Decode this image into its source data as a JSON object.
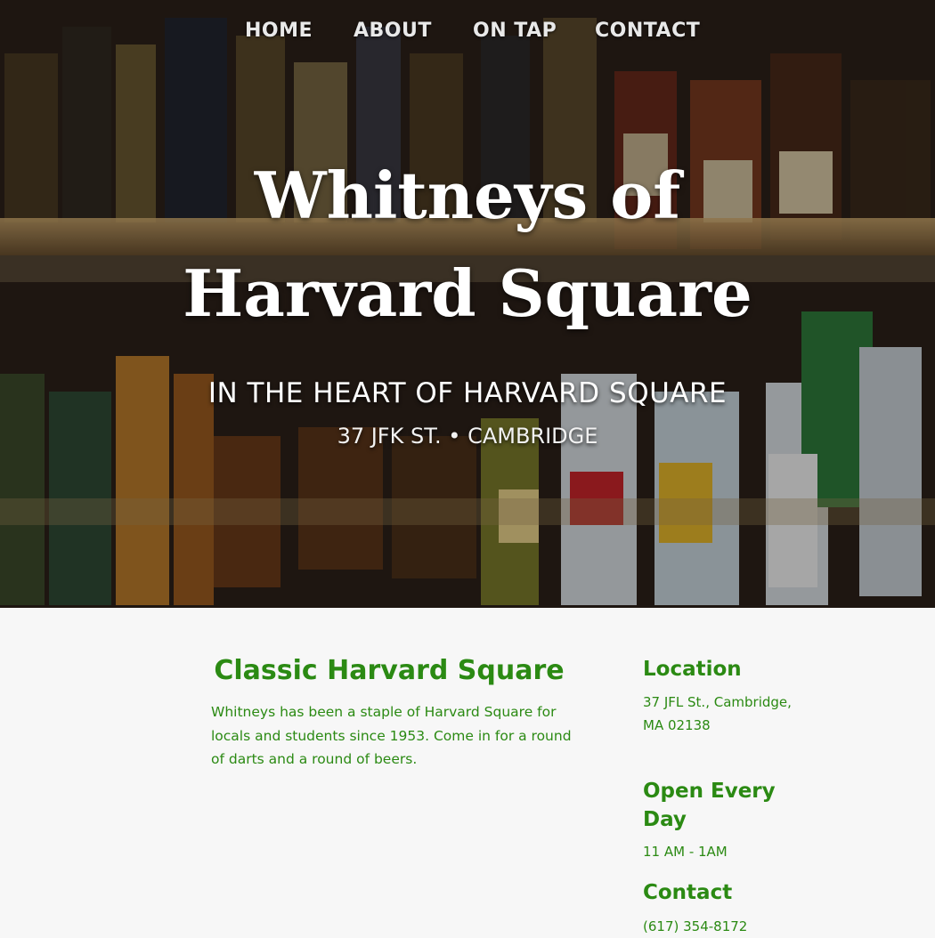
{
  "nav": {
    "items": [
      {
        "label": "HOME"
      },
      {
        "label": "ABOUT"
      },
      {
        "label": "ON TAP"
      },
      {
        "label": "CONTACT"
      }
    ]
  },
  "hero": {
    "title": "Whitneys of Harvard Square",
    "subtitle": "IN THE HEART OF HARVARD SQUARE",
    "address": "37 JFK ST. • CAMBRIDGE",
    "background": "bar-shelf-bottles-photo"
  },
  "intro": {
    "title": "Classic Harvard Square",
    "text": "Whitneys has been a staple of Harvard Square for locals and students since 1953. Come in for a round of darts and a round of beers."
  },
  "sidebar": {
    "location": {
      "heading": "Location",
      "text": "37 JFL St., Cambridge, MA 02138"
    },
    "hours": {
      "heading": "Open Every Day",
      "text": "11 AM - 1AM"
    },
    "contact": {
      "heading": "Contact",
      "text": "(617) 354-8172"
    }
  },
  "colors": {
    "accent": "#2b8a13",
    "background": "#f7f7f7",
    "hero_text": "#ffffff"
  }
}
